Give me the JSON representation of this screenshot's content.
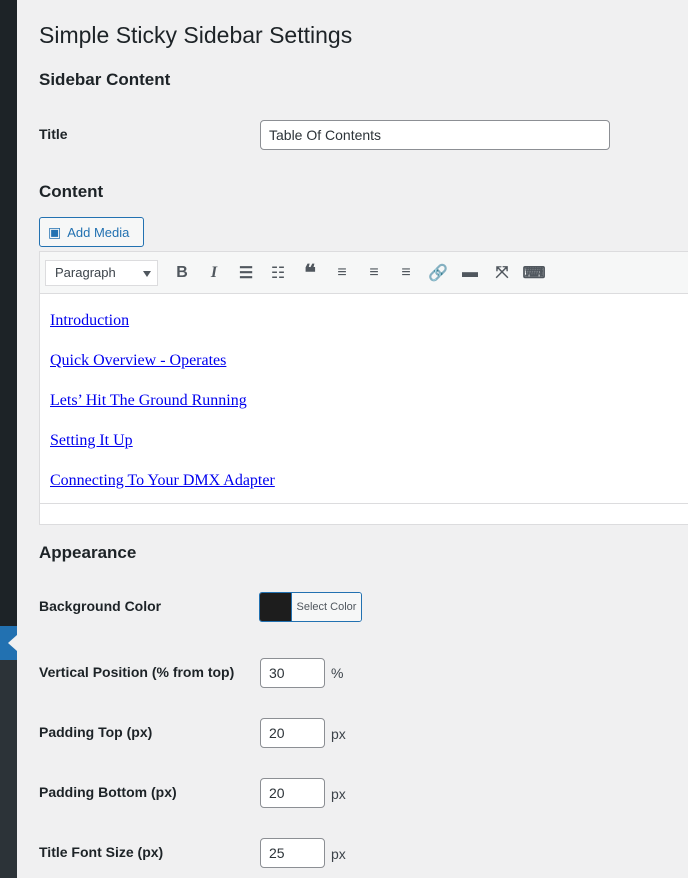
{
  "page_title": "Simple Sticky Sidebar Settings",
  "sections": {
    "content_heading": "Sidebar Content",
    "editor_heading": "Content",
    "appearance_heading": "Appearance"
  },
  "title_field": {
    "label": "Title",
    "value": "Table Of Contents"
  },
  "editor": {
    "add_media": "Add Media",
    "format": "Paragraph",
    "links": [
      "Introduction",
      "Quick Overview - Operates",
      "Lets’ Hit The Ground Running",
      "Setting It Up",
      "Connecting To Your DMX Adapter"
    ]
  },
  "appearance": {
    "bg_color": {
      "label": "Background Color",
      "button": "Select Color",
      "value": "#1d1d1d"
    },
    "vertical": {
      "label": "Vertical Position (% from top)",
      "value": "30",
      "unit": "%"
    },
    "padding_top": {
      "label": "Padding Top (px)",
      "value": "20",
      "unit": "px"
    },
    "padding_bottom": {
      "label": "Padding Bottom (px)",
      "value": "20",
      "unit": "px"
    },
    "title_font": {
      "label": "Title Font Size (px)",
      "value": "25",
      "unit": "px"
    }
  }
}
